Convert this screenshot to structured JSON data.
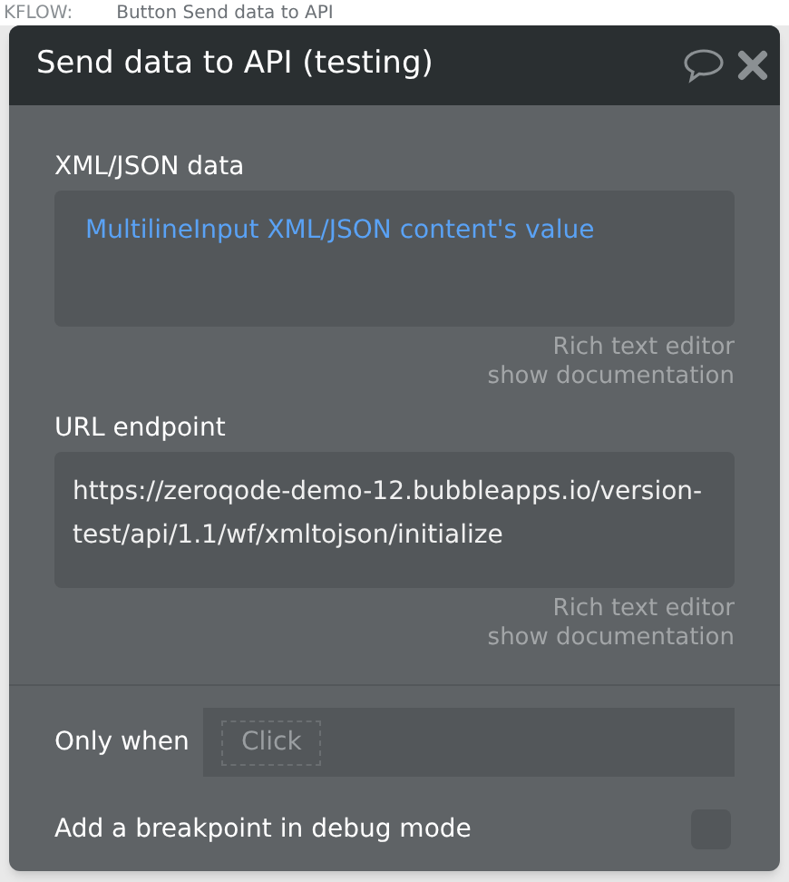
{
  "background": {
    "label": "KFLOW:",
    "title": "Button Send data to API"
  },
  "dialog": {
    "title": "Send data to API (testing)"
  },
  "fields": [
    {
      "label": "XML/JSON data",
      "value": "MultilineInput XML/JSON content's value",
      "kind": "dynamic",
      "hint": "Rich text editor",
      "link": "show documentation"
    },
    {
      "label": "URL endpoint",
      "value": "https://zeroqode-demo-12.bubbleapps.io/version-test/api/1.1/wf/xmltojson/initialize",
      "kind": "plain",
      "hint": "Rich text editor",
      "link": "show documentation"
    }
  ],
  "only_when": {
    "label": "Only when",
    "placeholder": "Click"
  },
  "breakpoint": {
    "label": "Add a breakpoint in debug mode",
    "checked": false
  }
}
